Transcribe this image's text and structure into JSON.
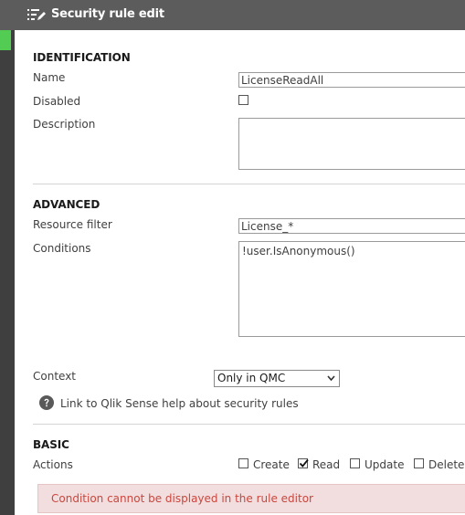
{
  "header": {
    "title": "Security rule edit",
    "icon": "edit-list-icon"
  },
  "identification": {
    "heading": "IDENTIFICATION",
    "name_label": "Name",
    "name_value": "LicenseReadAll",
    "disabled_label": "Disabled",
    "disabled_checked": false,
    "description_label": "Description",
    "description_value": ""
  },
  "advanced": {
    "heading": "ADVANCED",
    "resource_filter_label": "Resource filter",
    "resource_filter_value": "License_*",
    "conditions_label": "Conditions",
    "conditions_value": "!user.IsAnonymous()",
    "context_label": "Context",
    "context_value": "Only in QMC",
    "help_link": "Link to Qlik Sense help about security rules"
  },
  "basic": {
    "heading": "BASIC",
    "actions_label": "Actions",
    "actions": [
      {
        "label": "Create",
        "checked": false
      },
      {
        "label": "Read",
        "checked": true
      },
      {
        "label": "Update",
        "checked": false
      },
      {
        "label": "Delete",
        "checked": false
      }
    ],
    "error_message": "Condition cannot be displayed in the rule editor"
  },
  "colors": {
    "header_bg": "#5c5c5c",
    "rail_bg": "#3f3f3f",
    "accent_green": "#52cc52",
    "error_bg": "#f2dede",
    "error_text": "#c9473f"
  }
}
